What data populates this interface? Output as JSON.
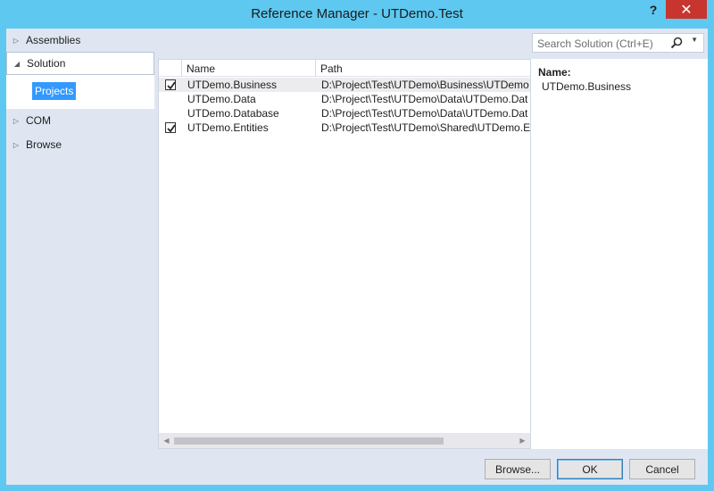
{
  "window": {
    "title": "Reference Manager - UTDemo.Test",
    "help_label": "?",
    "close_label": "✕"
  },
  "nav": {
    "items": [
      {
        "label": "Assemblies",
        "expanded": false
      },
      {
        "label": "Solution",
        "expanded": true
      },
      {
        "label": "COM",
        "expanded": false
      },
      {
        "label": "Browse",
        "expanded": false
      }
    ],
    "solution_children": [
      {
        "label": "Projects",
        "selected": true
      }
    ]
  },
  "search": {
    "placeholder": "Search Solution (Ctrl+E)",
    "icon": "search-icon"
  },
  "table": {
    "columns": [
      "Name",
      "Path"
    ],
    "rows": [
      {
        "checked": true,
        "name": "UTDemo.Business",
        "path": "D:\\Project\\Test\\UTDemo\\Business\\UTDemo",
        "selected": true
      },
      {
        "checked": false,
        "name": "UTDemo.Data",
        "path": "D:\\Project\\Test\\UTDemo\\Data\\UTDemo.Dat",
        "selected": false
      },
      {
        "checked": false,
        "name": "UTDemo.Database",
        "path": "D:\\Project\\Test\\UTDemo\\Data\\UTDemo.Dat",
        "selected": false
      },
      {
        "checked": true,
        "name": "UTDemo.Entities",
        "path": "D:\\Project\\Test\\UTDemo\\Shared\\UTDemo.E",
        "selected": false
      }
    ]
  },
  "detail": {
    "name_label": "Name:",
    "name_value": "UTDemo.Business"
  },
  "buttons": {
    "browse": "Browse...",
    "ok": "OK",
    "cancel": "Cancel"
  },
  "colors": {
    "titlebar": "#5ec8f0",
    "close": "#c7352e",
    "selection": "#3399ff",
    "client_bg": "#dfe6f1"
  }
}
